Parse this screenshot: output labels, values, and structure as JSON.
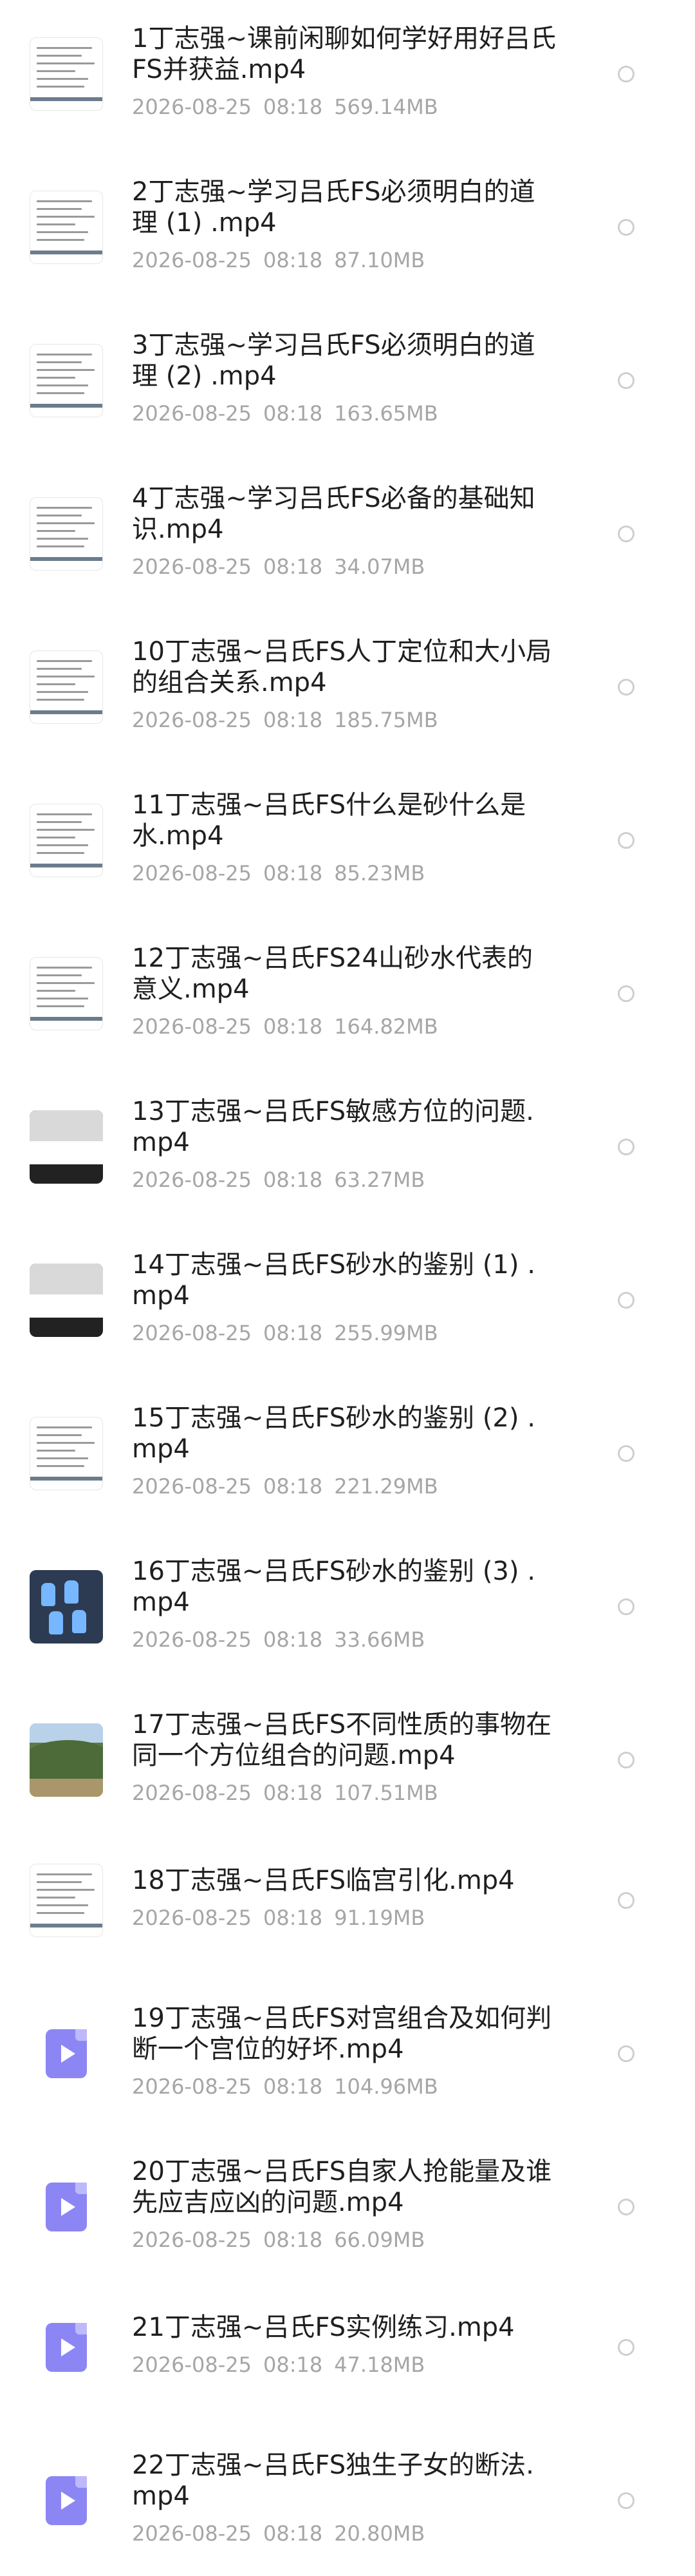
{
  "files": [
    {
      "title": "1丁志强~课前闲聊如何学好用好吕氏FS并获益.mp4",
      "date": "2026-08-25",
      "time": "08:18",
      "size": "569.14MB",
      "thumb": "doc",
      "lines": 2
    },
    {
      "title": "2丁志强~学习吕氏FS必须明白的道理 (1) .mp4",
      "date": "2026-08-25",
      "time": "08:18",
      "size": "87.10MB",
      "thumb": "doc",
      "lines": 2
    },
    {
      "title": "3丁志强~学习吕氏FS必须明白的道理 (2) .mp4",
      "date": "2026-08-25",
      "time": "08:18",
      "size": "163.65MB",
      "thumb": "doc",
      "lines": 2
    },
    {
      "title": "4丁志强~学习吕氏FS必备的基础知识.mp4",
      "date": "2026-08-25",
      "time": "08:18",
      "size": "34.07MB",
      "thumb": "doc",
      "lines": 2
    },
    {
      "title": "10丁志强~吕氏FS人丁定位和大小局的组合关系.mp4",
      "date": "2026-08-25",
      "time": "08:18",
      "size": "185.75MB",
      "thumb": "doc",
      "lines": 2
    },
    {
      "title": "11丁志强~吕氏FS什么是砂什么是水.mp4",
      "date": "2026-08-25",
      "time": "08:18",
      "size": "85.23MB",
      "thumb": "doc",
      "lines": 2
    },
    {
      "title": "12丁志强~吕氏FS24山砂水代表的意义.mp4",
      "date": "2026-08-25",
      "time": "08:18",
      "size": "164.82MB",
      "thumb": "doc",
      "lines": 2
    },
    {
      "title": "13丁志强~吕氏FS敏感方位的问题.mp4",
      "date": "2026-08-25",
      "time": "08:18",
      "size": "63.27MB",
      "thumb": "photo-dark",
      "lines": 2
    },
    {
      "title": "14丁志强~吕氏FS砂水的鉴别 (1) .mp4",
      "date": "2026-08-25",
      "time": "08:18",
      "size": "255.99MB",
      "thumb": "photo-dark",
      "lines": 2
    },
    {
      "title": "15丁志强~吕氏FS砂水的鉴别 (2) .mp4",
      "date": "2026-08-25",
      "time": "08:18",
      "size": "221.29MB",
      "thumb": "doc",
      "lines": 2
    },
    {
      "title": "16丁志强~吕氏FS砂水的鉴别 (3) .mp4",
      "date": "2026-08-25",
      "time": "08:18",
      "size": "33.66MB",
      "thumb": "photo-blue",
      "lines": 2
    },
    {
      "title": "17丁志强~吕氏FS不同性质的事物在同一个方位组合的问题.mp4",
      "date": "2026-08-25",
      "time": "08:18",
      "size": "107.51MB",
      "thumb": "photo-green",
      "lines": 2
    },
    {
      "title": "18丁志强~吕氏FS临宫引化.mp4",
      "date": "2026-08-25",
      "time": "08:18",
      "size": "91.19MB",
      "thumb": "doc",
      "lines": 1
    },
    {
      "title": "19丁志强~吕氏FS对宫组合及如何判断一个宫位的好坏.mp4",
      "date": "2026-08-25",
      "time": "08:18",
      "size": "104.96MB",
      "thumb": "video",
      "lines": 2
    },
    {
      "title": "20丁志强~吕氏FS自家人抢能量及谁先应吉应凶的问题.mp4",
      "date": "2026-08-25",
      "time": "08:18",
      "size": "66.09MB",
      "thumb": "video",
      "lines": 2
    },
    {
      "title": "21丁志强~吕氏FS实例练习.mp4",
      "date": "2026-08-25",
      "time": "08:18",
      "size": "47.18MB",
      "thumb": "video",
      "lines": 1
    },
    {
      "title": "22丁志强~吕氏FS独生子女的断法.mp4",
      "date": "2026-08-25",
      "time": "08:18",
      "size": "20.80MB",
      "thumb": "video",
      "lines": 2
    }
  ]
}
